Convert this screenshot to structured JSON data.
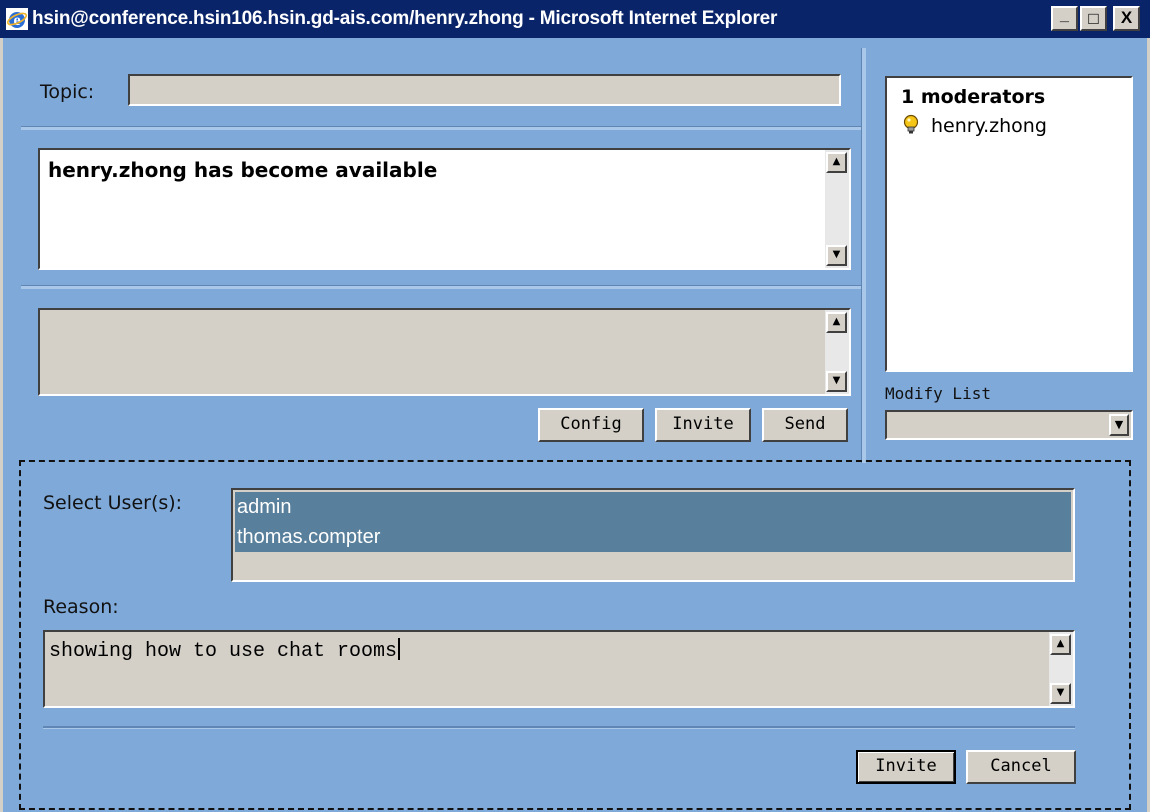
{
  "window": {
    "title": "hsin@conference.hsin106.hsin.gd-ais.com/henry.zhong - Microsoft Internet Explorer",
    "min_glyph": "_",
    "max_glyph": "□",
    "close_glyph": "X"
  },
  "topic": {
    "label": "Topic:",
    "value": ""
  },
  "chat_log": {
    "messages": [
      "henry.zhong has become available"
    ]
  },
  "message_input": {
    "value": ""
  },
  "actions": {
    "config": "Config",
    "invite": "Invite",
    "send": "Send"
  },
  "moderators": {
    "heading": "1 moderators",
    "users": [
      {
        "name": "henry.zhong",
        "icon": "lightbulb-icon"
      }
    ]
  },
  "modify_list": {
    "label": "Modify List",
    "selected": ""
  },
  "invite_panel": {
    "select_users_label": "Select User(s):",
    "users": [
      "admin",
      "thomas.compter"
    ],
    "reason_label": "Reason:",
    "reason_value": "showing how to use chat rooms",
    "invite_button": "Invite",
    "cancel_button": "Cancel"
  }
}
